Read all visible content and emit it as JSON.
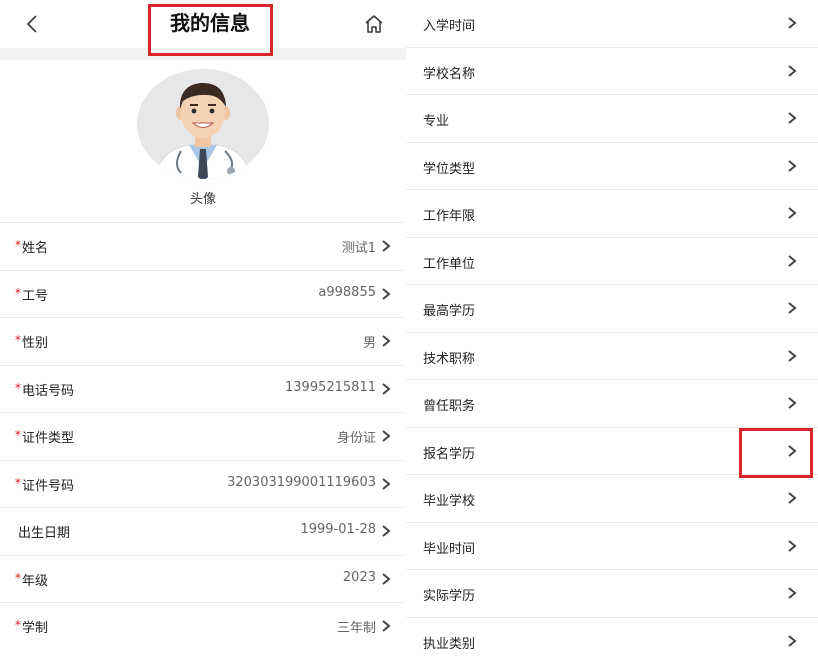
{
  "header": {
    "title": "我的信息",
    "back_icon": "chevron-left-icon",
    "home_icon": "home-icon"
  },
  "avatar": {
    "label": "头像"
  },
  "left_rows": [
    {
      "label": "姓名",
      "value": "测试1",
      "required": true
    },
    {
      "label": "工号",
      "value": "a998855",
      "required": true
    },
    {
      "label": "性别",
      "value": "男",
      "required": true
    },
    {
      "label": "电话号码",
      "value": "13995215811",
      "required": true
    },
    {
      "label": "证件类型",
      "value": "身份证",
      "required": true
    },
    {
      "label": "证件号码",
      "value": "320303199001119603",
      "required": true
    },
    {
      "label": "出生日期",
      "value": "1999-01-28",
      "required": false
    },
    {
      "label": "年级",
      "value": "2023",
      "required": true
    },
    {
      "label": "学制",
      "value": "三年制",
      "required": true
    }
  ],
  "required_mark": "*",
  "right_rows": [
    {
      "label": "入学时间"
    },
    {
      "label": "学校名称"
    },
    {
      "label": "专业"
    },
    {
      "label": "学位类型"
    },
    {
      "label": "工作年限"
    },
    {
      "label": "工作单位"
    },
    {
      "label": "最高学历"
    },
    {
      "label": "技术职称"
    },
    {
      "label": "曾任职务"
    },
    {
      "label": "报名学历"
    },
    {
      "label": "毕业学校"
    },
    {
      "label": "毕业时间"
    },
    {
      "label": "实际学历"
    },
    {
      "label": "执业类别"
    }
  ],
  "colors": {
    "highlight": "#d9262b",
    "required": "#e02020"
  }
}
